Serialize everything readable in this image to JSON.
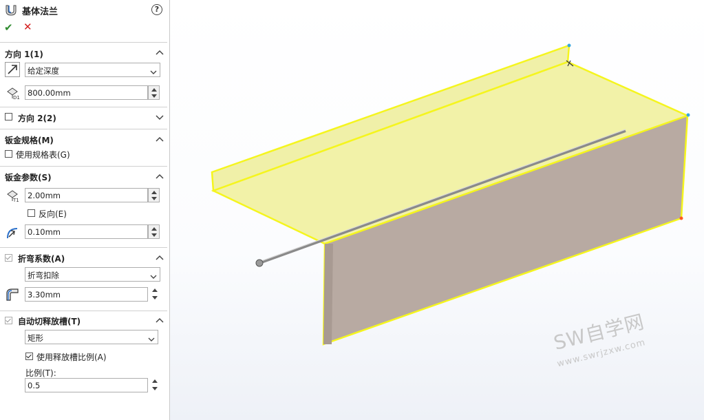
{
  "panel": {
    "title": "基体法兰",
    "help_icon": "?",
    "ok_icon": "✔",
    "cancel_icon": "✕"
  },
  "direction1": {
    "header": "方向 1(1)",
    "end_condition": "给定深度",
    "depth": "800.00mm"
  },
  "direction2": {
    "header": "方向 2(2)",
    "checked": false
  },
  "gauge": {
    "header": "钣金规格(M)",
    "use_table_label": "使用规格表(G)",
    "use_table_checked": false
  },
  "params": {
    "header": "钣金参数(S)",
    "thickness": "2.00mm",
    "reverse_label": "反向(E)",
    "reverse_checked": false,
    "radius": "0.10mm"
  },
  "bend": {
    "header": "折弯系数(A)",
    "type": "折弯扣除",
    "value": "3.30mm"
  },
  "relief": {
    "header": "自动切释放槽(T)",
    "type": "矩形",
    "use_ratio_label": "使用释放槽比例(A)",
    "use_ratio_checked": true,
    "ratio_label": "比例(T):",
    "ratio_value": "0.5"
  },
  "watermark": {
    "brand": "SW自学网",
    "url": "www.swrjzxw.com"
  },
  "colors": {
    "face": "#f2f2a8",
    "side": "#b8aaa2",
    "edge": "#f5f51e",
    "ok": "#2e8b2e",
    "cancel": "#d42020"
  }
}
